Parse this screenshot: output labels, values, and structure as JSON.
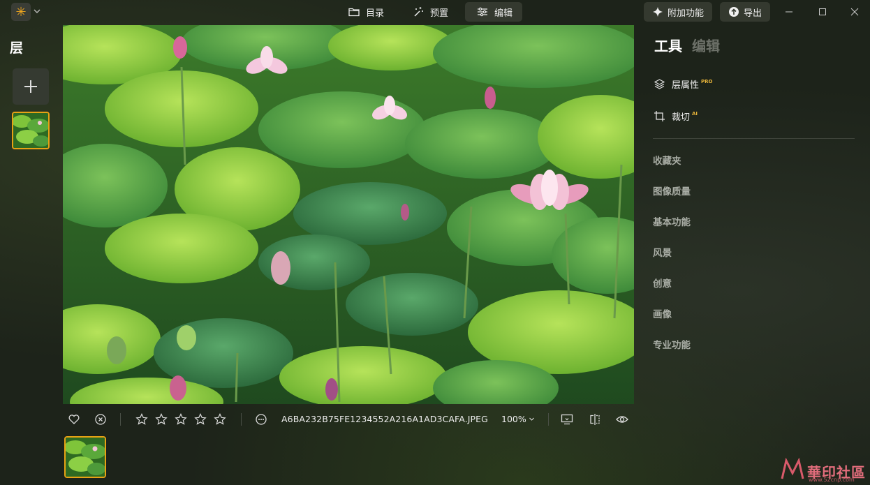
{
  "titlebar": {
    "tabs": [
      {
        "label": "目录",
        "icon": "folder-icon"
      },
      {
        "label": "预置",
        "icon": "magic-wand-icon"
      },
      {
        "label": "编辑",
        "icon": "sliders-icon",
        "active": true
      }
    ],
    "addons_label": "附加功能",
    "export_label": "导出"
  },
  "left_panel": {
    "title": "层"
  },
  "bottom_bar": {
    "filename": "A6BA232B75FE1234552A216A1AD3CAFA.JPEG",
    "zoom": "100%",
    "rating": 0,
    "rating_max": 5
  },
  "right_panel": {
    "tabs": [
      {
        "label": "工具",
        "active": true
      },
      {
        "label": "编辑",
        "active": false
      }
    ],
    "tools": [
      {
        "label": "层属性",
        "badge": "PRO",
        "icon": "layers-icon"
      },
      {
        "label": "裁切",
        "badge": "AI",
        "icon": "crop-icon"
      }
    ],
    "categories": [
      "收藏夹",
      "图像质量",
      "基本功能",
      "风景",
      "创意",
      "画像",
      "专业功能"
    ]
  },
  "watermark": {
    "text": "華印社區",
    "url": "www.52cnp.com"
  },
  "colors": {
    "accent": "#e7a214",
    "panel_bg": "#1d231a",
    "button_bg": "#34392f"
  }
}
